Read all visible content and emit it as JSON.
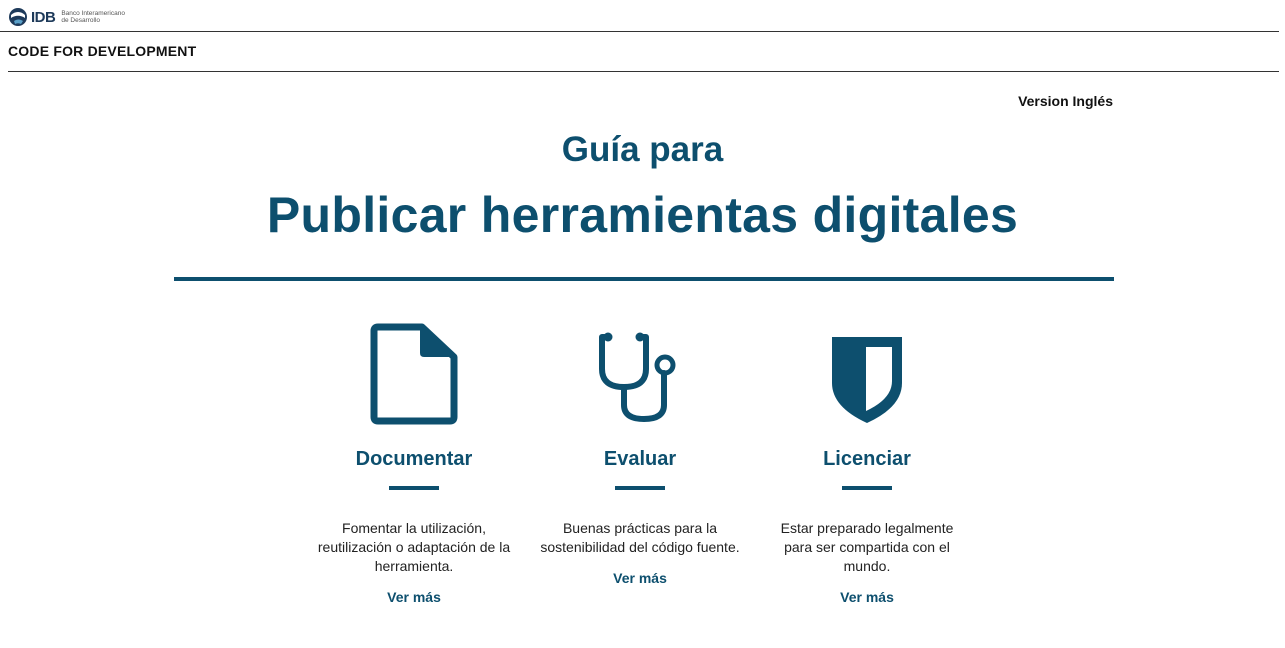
{
  "header": {
    "logo_text": "IDB",
    "logo_subtext_line1": "Banco Interamericano",
    "logo_subtext_line2": "de Desarrollo",
    "site_title": "CODE FOR DEVELOPMENT"
  },
  "language_link": "Version Inglés",
  "hero": {
    "kicker": "Guía para",
    "headline": "Publicar herramientas digitales"
  },
  "colors": {
    "accent": "#0d4f6e"
  },
  "cards": [
    {
      "icon": "document-icon",
      "title": "Documentar",
      "description": "Fomentar la utilización, reutilización o adaptación de la herramienta.",
      "link": "Ver más"
    },
    {
      "icon": "stethoscope-icon",
      "title": "Evaluar",
      "description": "Buenas prácticas para la sostenibilidad del código fuente.",
      "link": "Ver más"
    },
    {
      "icon": "shield-icon",
      "title": "Licenciar",
      "description": "Estar preparado legalmente para ser compartida con el mundo.",
      "link": "Ver más"
    }
  ]
}
